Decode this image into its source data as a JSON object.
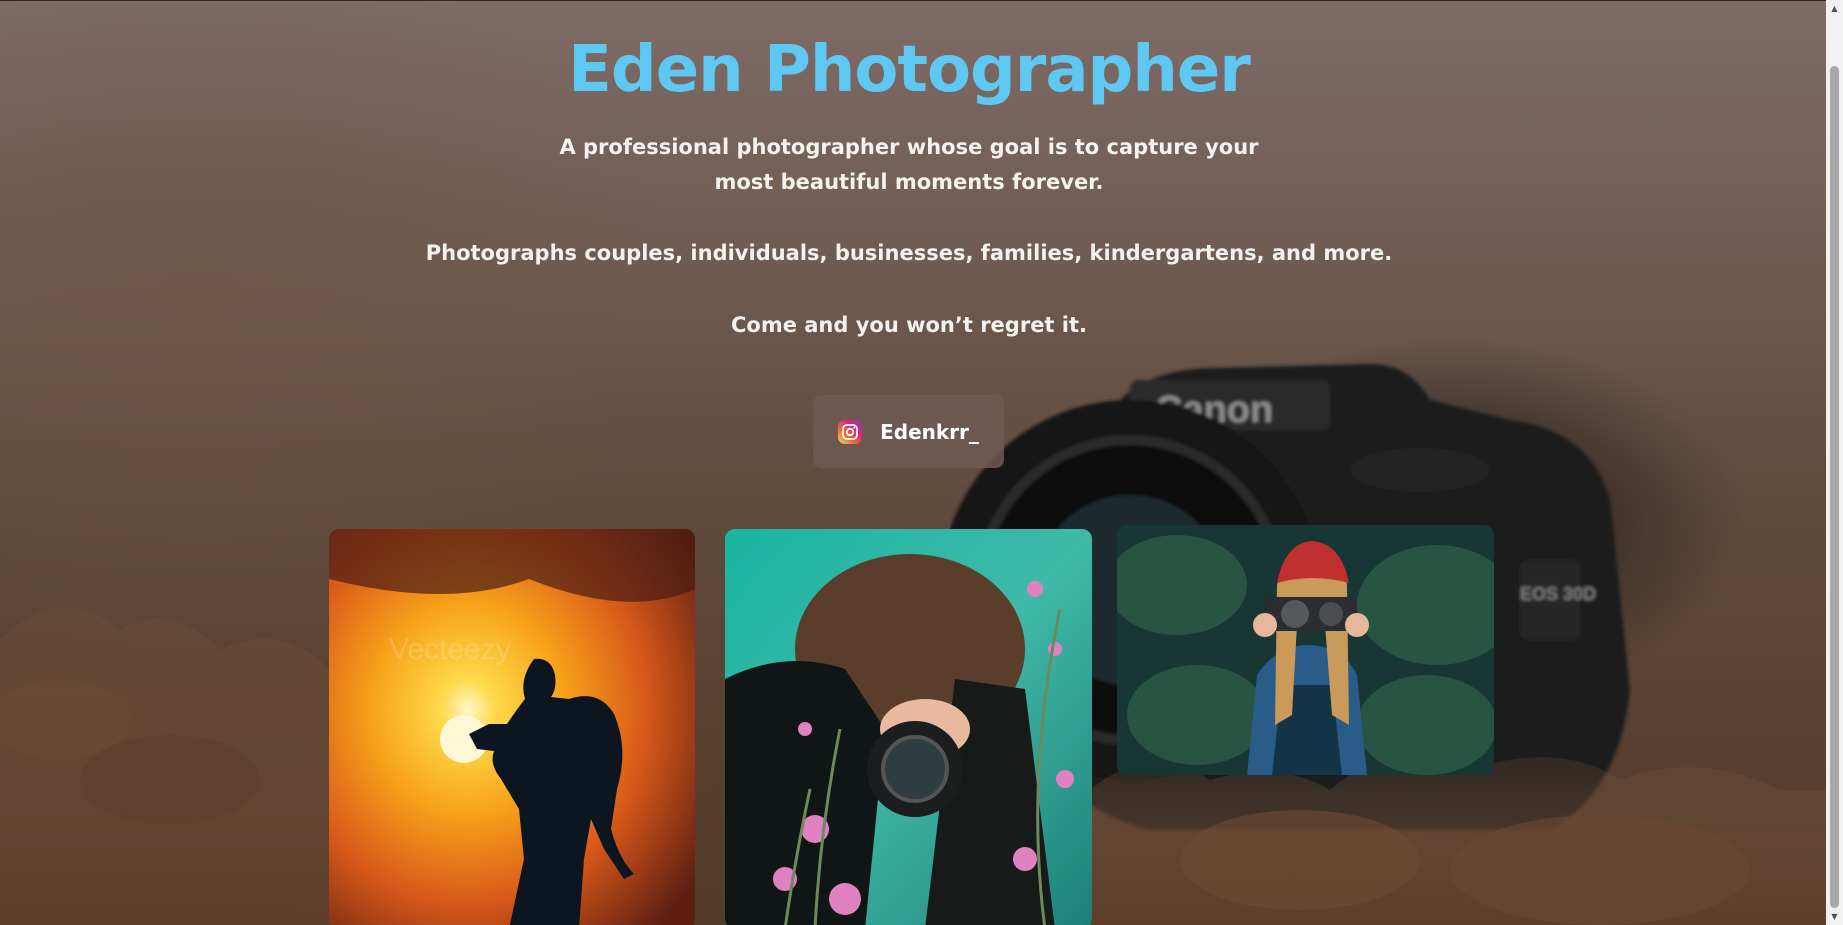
{
  "hero": {
    "title": "Eden Photographer",
    "description_line_1": "A professional photographer whose goal is to capture your most beautiful moments forever.",
    "description_line_2": "Photographs couples, individuals, businesses, families, kindergartens, and more.",
    "description_line_3": "Come and you won’t regret it."
  },
  "instagram": {
    "handle": "Edenkrr_",
    "icon": "instagram-icon"
  },
  "background": {
    "camera_brand": "Canon",
    "camera_model": "EOS 30D"
  },
  "gallery": [
    {
      "alt": "photographer-silhouette-sunset",
      "watermark": "Vecteezy"
    },
    {
      "alt": "woman-camera-flowers"
    },
    {
      "alt": "woman-red-beanie-camera"
    }
  ],
  "colors": {
    "title": "#5ec8f3",
    "text": "#f4f1ee",
    "button_bg": "#6e5a52"
  }
}
